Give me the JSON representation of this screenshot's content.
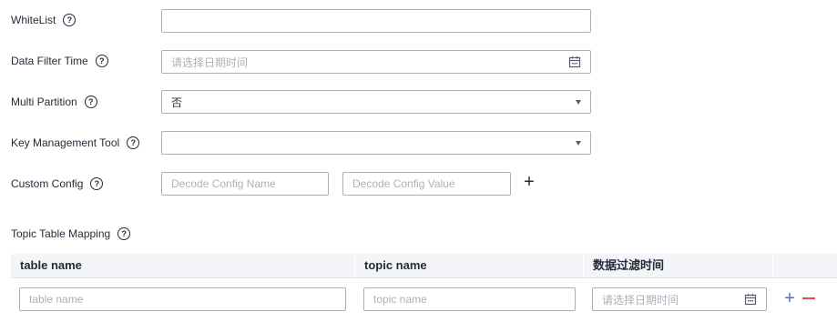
{
  "form": {
    "whitelist": {
      "label": "WhiteList",
      "value": ""
    },
    "data_filter_time": {
      "label": "Data Filter Time",
      "placeholder": "请选择日期时间"
    },
    "multi_partition": {
      "label": "Multi Partition",
      "value": "否"
    },
    "key_management_tool": {
      "label": "Key Management Tool",
      "value": ""
    },
    "custom_config": {
      "label": "Custom Config",
      "name_placeholder": "Decode Config Name",
      "value_placeholder": "Decode Config Value",
      "add_label": "+"
    },
    "help_glyph": "?"
  },
  "mapping": {
    "label": "Topic Table Mapping",
    "columns": [
      "table name",
      "topic name",
      "数据过滤时间"
    ],
    "row": {
      "table_placeholder": "table name",
      "topic_placeholder": "topic name",
      "time_placeholder": "请选择日期时间"
    },
    "add_label": "+",
    "remove_label": "−"
  },
  "colors": {
    "accent": "#526ecc",
    "danger": "#e54545",
    "border": "#adb0b8",
    "header_bg": "#f3f5f8"
  },
  "icons": [
    "help-icon",
    "calendar-icon",
    "chevron-down-icon",
    "plus-icon",
    "minus-icon"
  ]
}
